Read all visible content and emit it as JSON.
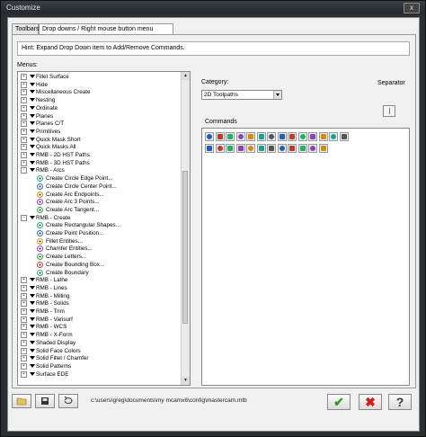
{
  "window": {
    "title": "Customize",
    "close_label": "x"
  },
  "tabs": [
    {
      "label": "Toolbars",
      "active": false
    },
    {
      "label": "Drop downs / Right mouse button menu",
      "active": true
    }
  ],
  "hint": "Hint:  Expand Drop Down item to Add/Remove Commands.",
  "menus_label": "Menus:",
  "category": {
    "label": "Category:",
    "value": "2D Toolpaths"
  },
  "separator_label": "Separator",
  "commands_label": "Commands",
  "tree": [
    {
      "label": "Fillet Surface",
      "level": 0,
      "expander": "+",
      "icon": "menu-arrow"
    },
    {
      "label": "Hide",
      "level": 0,
      "expander": "+",
      "icon": "menu-arrow"
    },
    {
      "label": "Miscellaneous Create",
      "level": 0,
      "expander": "+",
      "icon": "menu-arrow"
    },
    {
      "label": "Nesting",
      "level": 0,
      "expander": "+",
      "icon": "menu-arrow"
    },
    {
      "label": "Ordinate",
      "level": 0,
      "expander": "+",
      "icon": "menu-arrow"
    },
    {
      "label": "Planes",
      "level": 0,
      "expander": "+",
      "icon": "menu-arrow"
    },
    {
      "label": "Planes C/T",
      "level": 0,
      "expander": "+",
      "icon": "menu-arrow"
    },
    {
      "label": "Primitives",
      "level": 0,
      "expander": "+",
      "icon": "menu-arrow"
    },
    {
      "label": "Quick Mask Short",
      "level": 0,
      "expander": "+",
      "icon": "menu-arrow"
    },
    {
      "label": "Quick Masks All",
      "level": 0,
      "expander": "+",
      "icon": "menu-arrow"
    },
    {
      "label": "RMB - 2D HST Paths",
      "level": 0,
      "expander": "+",
      "icon": "menu-arrow"
    },
    {
      "label": "RMB - 3D HST Paths",
      "level": 0,
      "expander": "+",
      "icon": "menu-arrow"
    },
    {
      "label": "RMB - Arcs",
      "level": 0,
      "expander": "-",
      "icon": "menu-arrow"
    },
    {
      "label": "Create Circle Edge Point...",
      "level": 1,
      "icon": "circle-edge-point-icon"
    },
    {
      "label": "Create Circle Center Point...",
      "level": 1,
      "icon": "circle-center-point-icon"
    },
    {
      "label": "Create Arc Endpoints...",
      "level": 1,
      "icon": "arc-endpoints-icon"
    },
    {
      "label": "Create Arc 3 Points...",
      "level": 1,
      "icon": "arc-3-points-icon"
    },
    {
      "label": "Create Arc Tangent...",
      "level": 1,
      "icon": "arc-tangent-icon"
    },
    {
      "label": "RMB - Create",
      "level": 0,
      "expander": "-",
      "icon": "menu-arrow"
    },
    {
      "label": "Create Rectangular Shapes...",
      "level": 1,
      "icon": "rectangular-shapes-icon"
    },
    {
      "label": "Create Point Position...",
      "level": 1,
      "icon": "point-position-icon"
    },
    {
      "label": "Fillet Entities...",
      "level": 1,
      "icon": "fillet-entities-icon"
    },
    {
      "label": "Chamfer Entities...",
      "level": 1,
      "icon": "chamfer-entities-icon"
    },
    {
      "label": "Create Letters...",
      "level": 1,
      "icon": "letters-icon"
    },
    {
      "label": "Create Bounding Box...",
      "level": 1,
      "icon": "bounding-box-icon"
    },
    {
      "label": "Create Boundary",
      "level": 1,
      "icon": "boundary-icon"
    },
    {
      "label": "RMB - Lathe",
      "level": 0,
      "expander": "+",
      "icon": "menu-arrow"
    },
    {
      "label": "RMB - Lines",
      "level": 0,
      "expander": "+",
      "icon": "menu-arrow"
    },
    {
      "label": "RMB - Milling",
      "level": 0,
      "expander": "+",
      "icon": "menu-arrow"
    },
    {
      "label": "RMB - Solids",
      "level": 0,
      "expander": "+",
      "icon": "menu-arrow"
    },
    {
      "label": "RMB - Trim",
      "level": 0,
      "expander": "+",
      "icon": "menu-arrow"
    },
    {
      "label": "RMB - Varisurf",
      "level": 0,
      "expander": "+",
      "icon": "menu-arrow"
    },
    {
      "label": "RMB - WCS",
      "level": 0,
      "expander": "+",
      "icon": "menu-arrow"
    },
    {
      "label": "RMB - X-Form",
      "level": 0,
      "expander": "+",
      "icon": "menu-arrow"
    },
    {
      "label": "Shaded Display",
      "level": 0,
      "expander": "+",
      "icon": "menu-arrow"
    },
    {
      "label": "Solid Face Colors",
      "level": 0,
      "expander": "+",
      "icon": "menu-arrow"
    },
    {
      "label": "Solid Fillet / Chamfer",
      "level": 0,
      "expander": "+",
      "icon": "menu-arrow"
    },
    {
      "label": "Solid Patterns",
      "level": 0,
      "expander": "+",
      "icon": "menu-arrow"
    },
    {
      "label": "Surface EDE",
      "level": 0,
      "expander": "+",
      "icon": "menu-arrow"
    }
  ],
  "command_icons": [
    "contour-toolpath-icon",
    "drill-toolpath-icon",
    "pocket-toolpath-icon",
    "facing-toolpath-icon",
    "circle-mill-icon",
    "helix-bore-icon",
    "thread-mill-icon",
    "slot-mill-icon",
    "engrave-icon",
    "transform-icon",
    "peel-mill-icon",
    "block-drill-icon",
    "dynamic-mill-icon",
    "area-mill-icon",
    "chamfer-drill-icon",
    "model-chamfer-icon",
    "feature-drill-icon",
    "multi-pass-icon",
    "swept-2d-icon",
    "revolved-icon",
    "lofted-icon",
    "ruled-icon",
    "swept-3d-icon",
    "point-toolpath-icon",
    "wireframe-icon",
    "trim-toolpath-icon"
  ],
  "footer": {
    "open_icon": "open-folder-icon",
    "save_icon": "save-icon",
    "reset_icon": "reset-icon",
    "path": "c:\\users\\greg\\documents\\my mcamx6\\config\\mastercam.mtb",
    "ok_symbol": "✔",
    "cancel_symbol": "✖",
    "help_symbol": "?"
  },
  "colors": {
    "ok": "#2e9b1e",
    "cancel": "#d21c10",
    "help": "#3a3a3a",
    "icon_blue": "#2a5db0"
  }
}
